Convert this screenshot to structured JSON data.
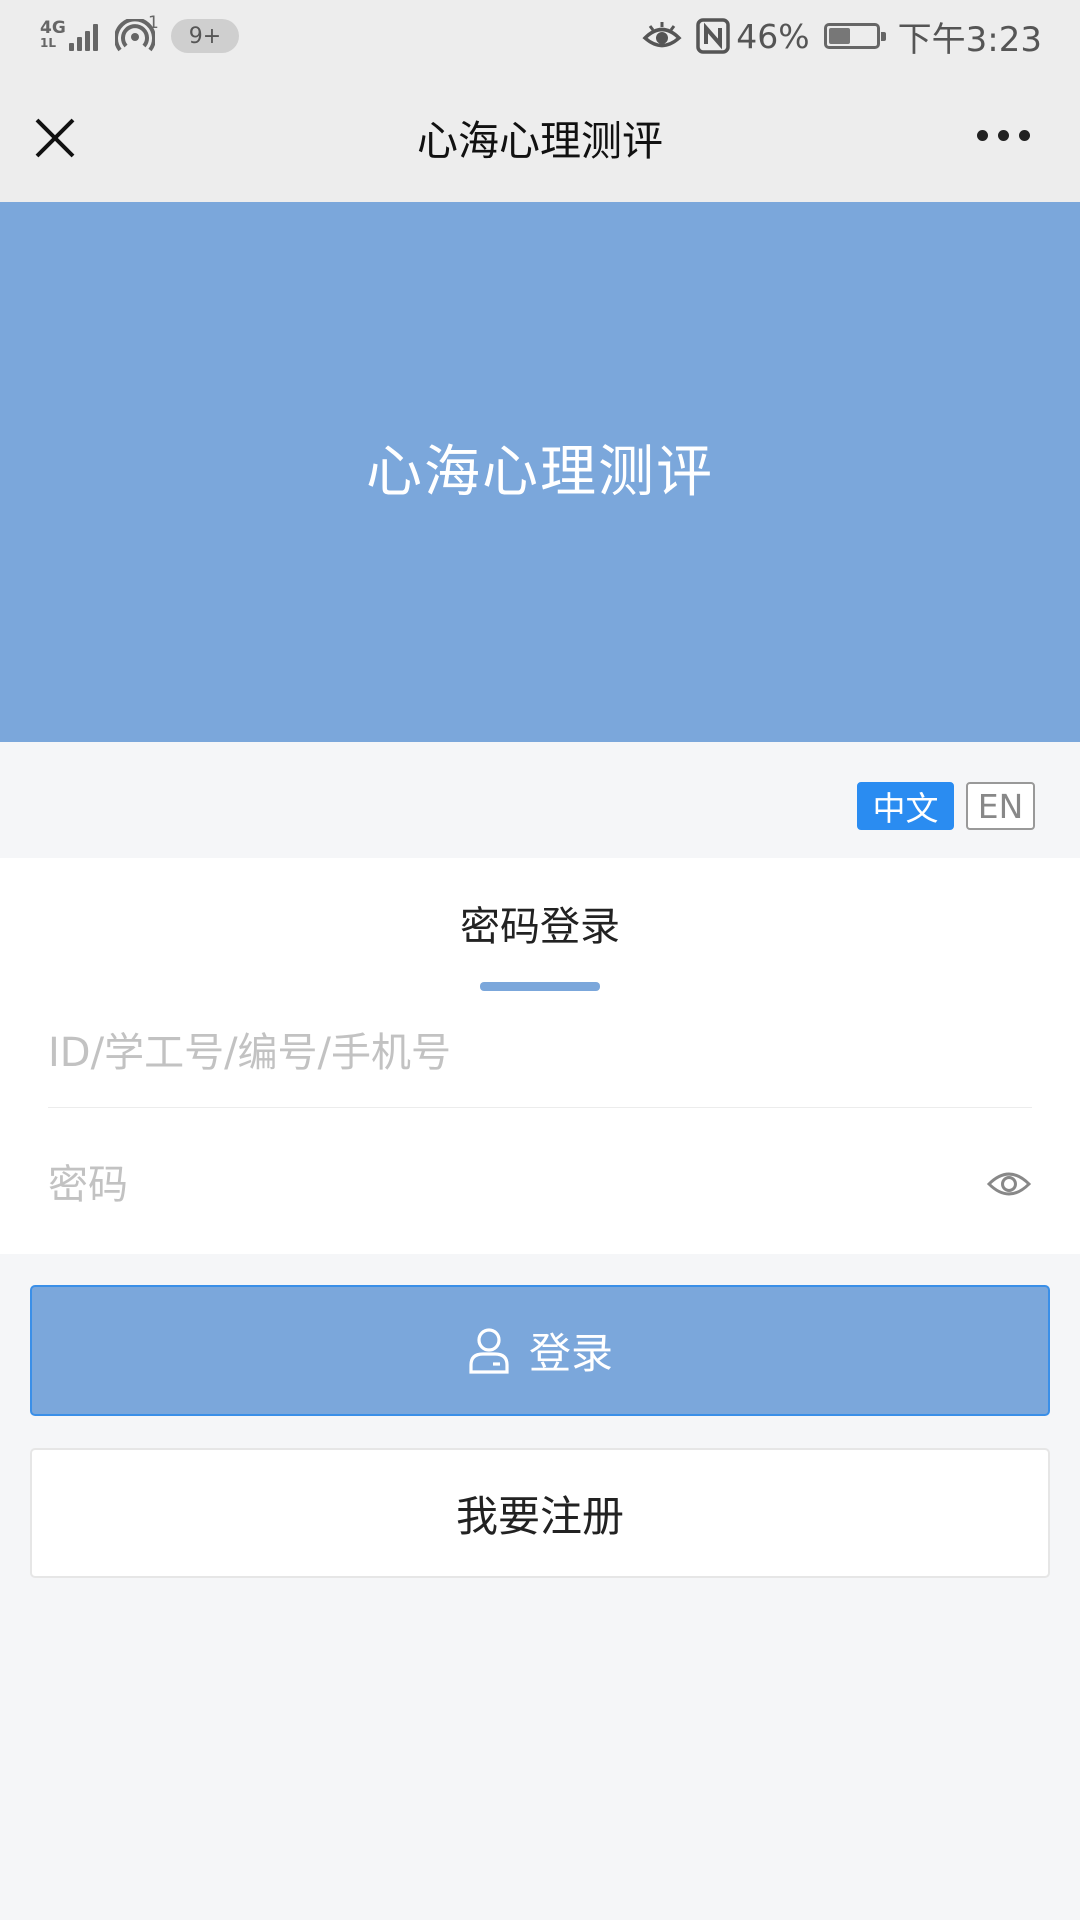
{
  "status_bar": {
    "network": "4G",
    "network_sub": "1L",
    "hotspot_count": "1",
    "notification_badge": "9+",
    "battery_percent": "46%",
    "time": "下午3:23",
    "icons": [
      "signal-icon",
      "hotspot-icon",
      "eye-comfort-icon",
      "nfc-icon",
      "battery-icon"
    ]
  },
  "title_bar": {
    "title": "心海心理测评",
    "close_icon": "close-icon",
    "more_icon": "more-icon"
  },
  "hero": {
    "title": "心海心理测评",
    "background": "#7ba7db"
  },
  "language": {
    "options": [
      "中文",
      "EN"
    ],
    "selected": "中文",
    "accent": "#2a8cf1"
  },
  "login_form": {
    "tab_label": "密码登录",
    "id_field": {
      "value": "",
      "placeholder": "ID/学工号/编号/手机号"
    },
    "password_field": {
      "value": "",
      "placeholder": "密码"
    },
    "show_password_icon": "eye-icon"
  },
  "actions": {
    "login_label": "登录",
    "login_icon": "user-icon",
    "register_label": "我要注册"
  }
}
